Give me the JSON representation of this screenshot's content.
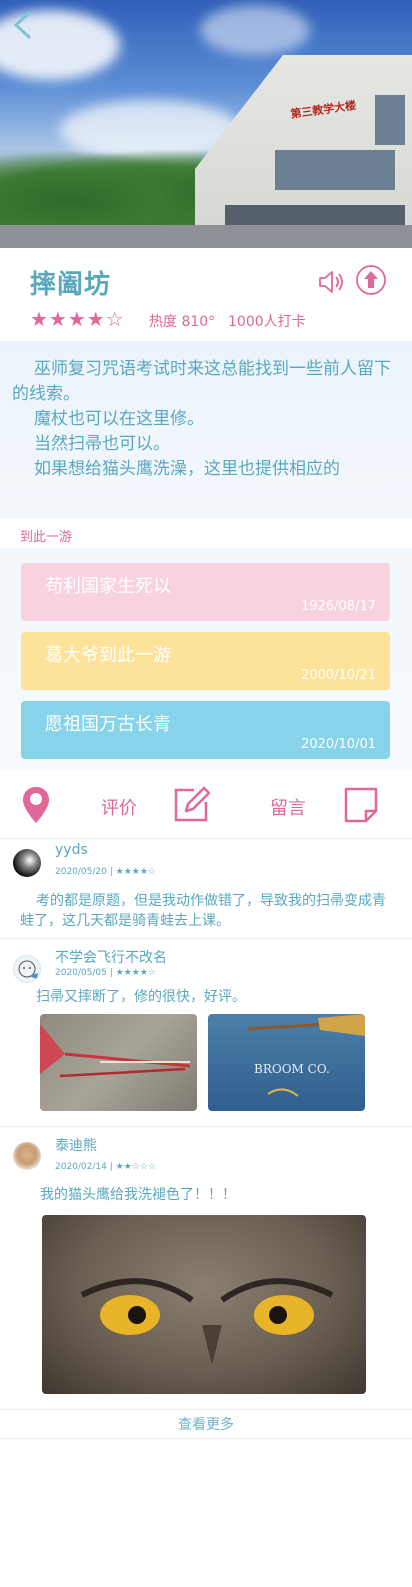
{
  "place": {
    "title": "摔阖坊",
    "stars": "★★★★☆",
    "heat": "热度 810°",
    "checkins": "1000人打卡"
  },
  "hero": {
    "sign_text": "第三教学大楼"
  },
  "description": [
    "巫师复习咒语考试时来这总能找到一些前人留下的线索。",
    "魔杖也可以在这里修。",
    "当然扫帚也可以。",
    "如果想给猫头鹰洗澡，这里也提供相应的"
  ],
  "visits": {
    "label": "到此一游",
    "cards": [
      {
        "text": "苟利国家生死以",
        "date": "1926/08/17",
        "color": "#f8d3df"
      },
      {
        "text": "葛大爷到此一游",
        "date": "2000/10/21",
        "color": "#fde39a"
      },
      {
        "text": "愿祖国万古长青",
        "date": "2020/10/01",
        "color": "#86d3ea"
      }
    ]
  },
  "actions": {
    "evaluate": "评价",
    "message": "留言"
  },
  "comments": [
    {
      "name": "yyds",
      "meta": "2020/05/20 | ★★★★☆",
      "body": "考的都是原题，但是我动作做错了，导致我的扫帚变成青蛙了，这几天都是骑青蛙去上课。"
    },
    {
      "name": "不学会飞行不改名",
      "meta": "2020/05/05 | ★★★★☆",
      "body": "扫帚又摔断了，修的很快，好评。",
      "photo2_text": "BROOM CO."
    },
    {
      "name": "泰迪熊",
      "meta": "2020/02/14 | ★★☆☆☆",
      "body": "我的猫头鹰给我洗褪色了！！！"
    }
  ],
  "footer": {
    "more": "查看更多"
  },
  "colors": {
    "accent_pink": "#e0679a",
    "accent_teal": "#5aa8be"
  }
}
